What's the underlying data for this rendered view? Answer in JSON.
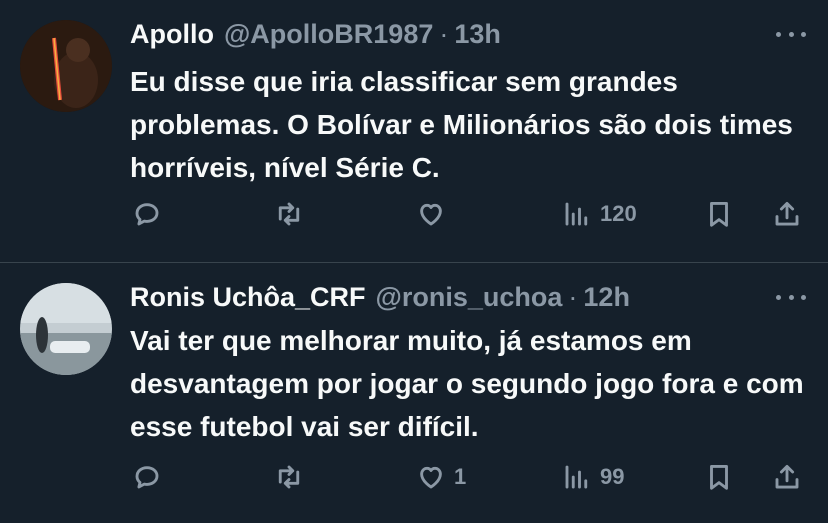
{
  "tweets": [
    {
      "name": "Apollo",
      "handle": "@ApolloBR1987",
      "separator": "·",
      "time": "13h",
      "text": "Eu disse que iria classificar sem grandes problemas. O Bolívar e Milionários são dois times horríveis, nível Série C.",
      "actions": {
        "reply": "",
        "retweet": "",
        "like": "",
        "views": "120"
      },
      "avatar_colors": [
        "#2a1a12",
        "#c0392b",
        "#f39c12"
      ]
    },
    {
      "name": "Ronis Uchôa_CRF",
      "handle": "@ronis_uchoa",
      "separator": "·",
      "time": "12h",
      "text": "Vai ter que melhorar muito, já estamos em desvantagem por jogar o segundo jogo fora e com esse futebol vai ser difícil.",
      "actions": {
        "reply": "",
        "retweet": "",
        "like": "1",
        "views": "99"
      },
      "avatar_colors": [
        "#b7c3c9",
        "#7c8a90",
        "#2c3338"
      ]
    }
  ],
  "icons": {
    "reply": "reply-icon",
    "retweet": "retweet-icon",
    "like": "like-icon",
    "views": "views-icon",
    "bookmark": "bookmark-icon",
    "share": "share-icon",
    "more": "more-icon"
  },
  "colors": {
    "background": "#15202b",
    "text": "#f7f9f9",
    "muted": "#8b98a5",
    "divider": "#38444d"
  }
}
